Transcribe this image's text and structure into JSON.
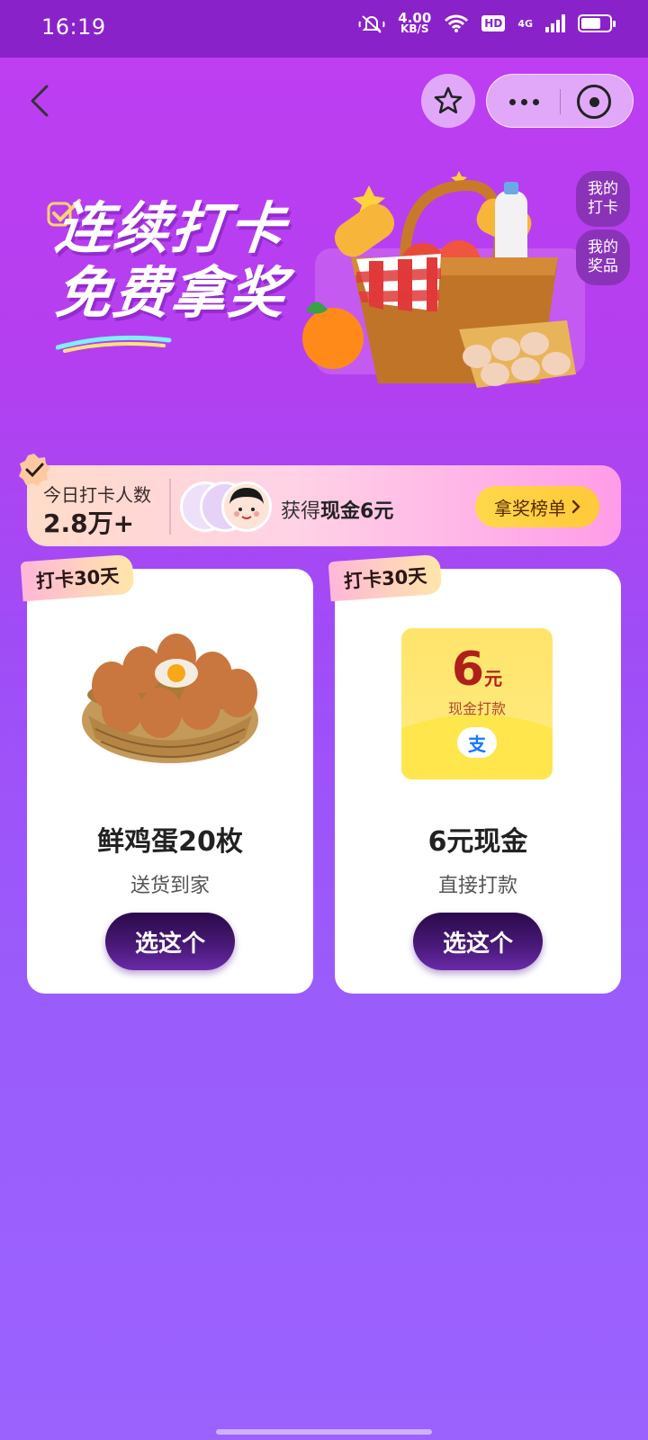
{
  "status_bar": {
    "time": "16:19",
    "speed_value": "4.00",
    "speed_unit": "KB/S",
    "hd": "HD",
    "network": "4G"
  },
  "nav": {
    "back_icon": "chevron-left-icon",
    "favorite_icon": "star-icon",
    "more_icon": "more-dots-icon",
    "close_icon": "target-circle-icon"
  },
  "banner": {
    "line1": "连续打卡",
    "line2": "免费拿奖"
  },
  "side_buttons": {
    "my_checkin": "我的打卡",
    "my_prizes": "我的奖品"
  },
  "stats": {
    "label": "今日打卡人数",
    "value": "2.8万+",
    "award_prefix": "获得",
    "award_value": "现金6元",
    "rank_button": "拿奖榜单"
  },
  "cards": [
    {
      "tag": "打卡30天",
      "title": "鲜鸡蛋20枚",
      "subtitle": "送货到家",
      "button": "选这个"
    },
    {
      "tag": "打卡30天",
      "title": "6元现金",
      "subtitle": "直接打款",
      "button": "选这个",
      "cash_amount": "6",
      "cash_unit": "元",
      "cash_label": "现金打款",
      "cash_icon": "支"
    }
  ],
  "colors": {
    "primary_purple": "#b43ff0",
    "button_dark": "#2a0a4a",
    "rank_yellow": "#ffd84a",
    "cash_red": "#b0201a"
  }
}
